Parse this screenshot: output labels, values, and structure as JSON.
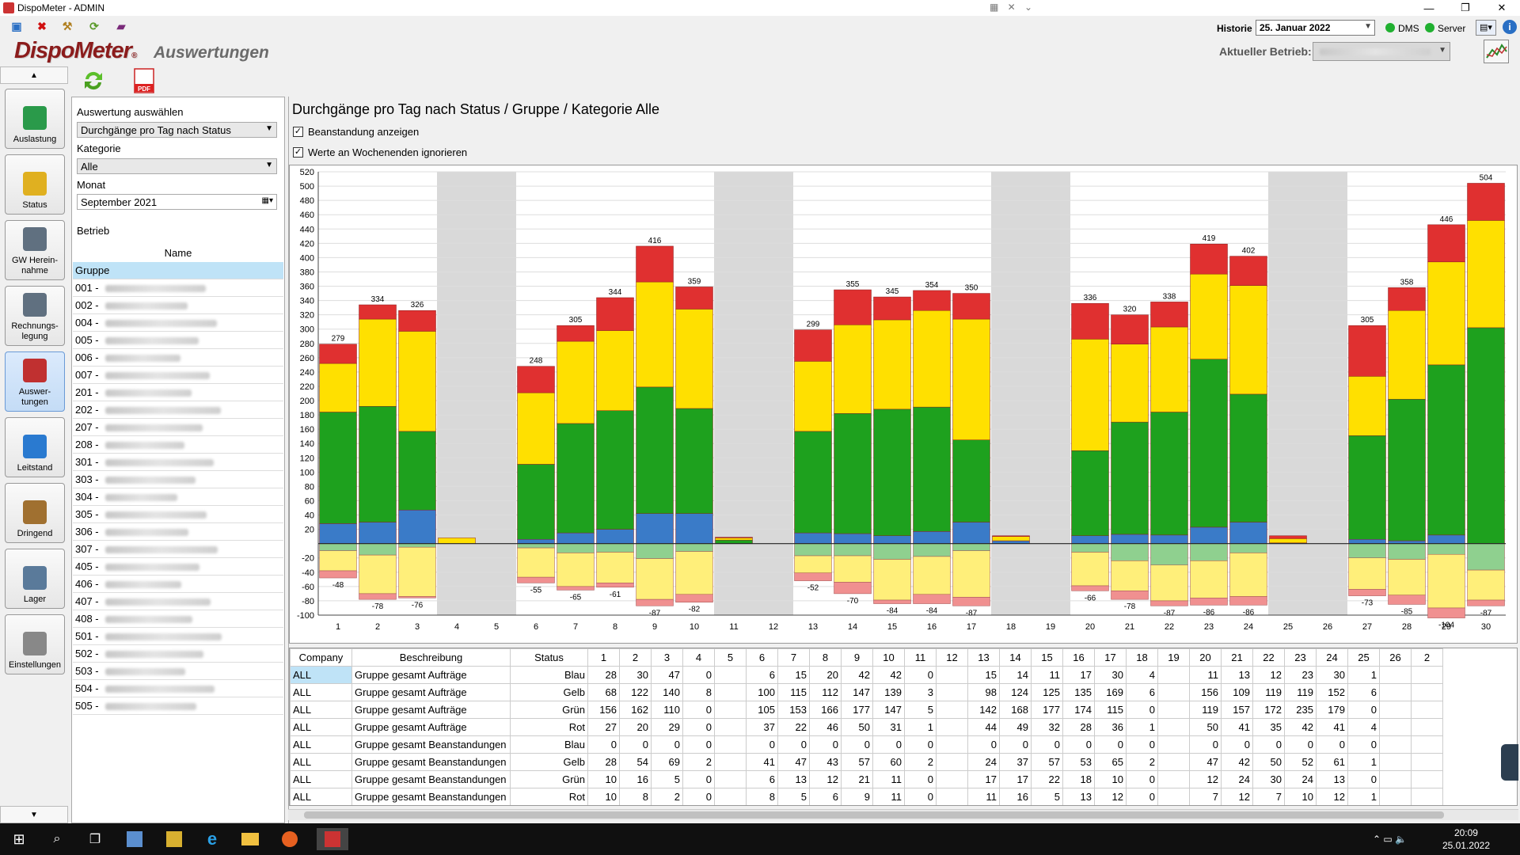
{
  "window": {
    "title": "DispoMeter - ADMIN"
  },
  "header": {
    "historie_label": "Historie",
    "historie_value": "25. Januar 2022",
    "dms_label": "DMS",
    "server_label": "Server",
    "logo": "DispoMeter",
    "subtitle": "Auswertungen",
    "betrieb_label": "Aktueller Betrieb:"
  },
  "nav": [
    {
      "label": "Auslastung",
      "icon": "cubes-icon",
      "active": false
    },
    {
      "label": "Status",
      "icon": "clipboard-icon",
      "active": false
    },
    {
      "label": "GW Herein-\nnahme",
      "icon": "car-icon",
      "active": false
    },
    {
      "label": "Rechnungs-\nlegung",
      "icon": "calculator-icon",
      "active": false
    },
    {
      "label": "Auswer-\ntungen",
      "icon": "chart-icon",
      "active": true
    },
    {
      "label": "Leitstand",
      "icon": "monitor-icon",
      "active": false
    },
    {
      "label": "Dringend",
      "icon": "moneybag-icon",
      "active": false
    },
    {
      "label": "Lager",
      "icon": "basket-icon",
      "active": false
    },
    {
      "label": "Einstellungen",
      "icon": "gear-icon",
      "active": false
    }
  ],
  "left": {
    "auswertung_label": "Auswertung auswählen",
    "auswertung_value": "Durchgänge pro Tag nach Status",
    "kategorie_label": "Kategorie",
    "kategorie_value": "Alle",
    "monat_label": "Monat",
    "monat_value": "September 2021",
    "betrieb_label": "Betrieb",
    "name_header": "Name",
    "rows": [
      "Gruppe",
      "001 -",
      "002 -",
      "004 -",
      "005 -",
      "006 -",
      "007 -",
      "201 -",
      "202 -",
      "207 -",
      "208 -",
      "301 -",
      "303 -",
      "304 -",
      "305 -",
      "306 -",
      "307 -",
      "405 -",
      "406 -",
      "407 -",
      "408 -",
      "501 -",
      "502 -",
      "503 -",
      "504 -",
      "505 -"
    ]
  },
  "main": {
    "title": "Durchgänge pro Tag nach Status / Gruppe / Kategorie Alle",
    "check1": "Beanstandung anzeigen",
    "check2": "Werte an Wochenenden ignorieren"
  },
  "colors": {
    "blau": "#3a7bc8",
    "gelb": "#ffe000",
    "gruen": "#1ea11e",
    "rot": "#e03030",
    "weekend": "#d9d9d9"
  },
  "chart_data": {
    "type": "bar",
    "stacked": true,
    "x": [
      1,
      2,
      3,
      4,
      5,
      6,
      7,
      8,
      9,
      10,
      11,
      12,
      13,
      14,
      15,
      16,
      17,
      18,
      19,
      20,
      21,
      22,
      23,
      24,
      25,
      26,
      27,
      28,
      29,
      30
    ],
    "weekend_days": [
      4,
      5,
      11,
      12,
      18,
      19,
      25,
      26
    ],
    "ylim": [
      -100,
      520
    ],
    "yticks": [
      -100,
      -80,
      -60,
      -40,
      -20,
      20,
      40,
      60,
      80,
      100,
      120,
      140,
      160,
      180,
      200,
      220,
      240,
      260,
      280,
      300,
      320,
      340,
      360,
      380,
      400,
      420,
      440,
      460,
      480,
      500,
      520
    ],
    "series": [
      {
        "name": "Blau",
        "values": [
          28,
          30,
          47,
          0,
          0,
          6,
          15,
          20,
          42,
          42,
          0,
          0,
          15,
          14,
          11,
          17,
          30,
          4,
          0,
          11,
          13,
          12,
          23,
          30,
          1,
          0,
          6,
          4,
          12,
          0
        ]
      },
      {
        "name": "Grün",
        "values": [
          156,
          162,
          110,
          0,
          0,
          105,
          153,
          166,
          177,
          147,
          5,
          0,
          142,
          168,
          177,
          174,
          115,
          0,
          0,
          119,
          157,
          172,
          235,
          179,
          0,
          0,
          145,
          198,
          238,
          302
        ]
      },
      {
        "name": "Gelb",
        "values": [
          68,
          122,
          140,
          8,
          0,
          100,
          115,
          112,
          147,
          139,
          3,
          0,
          98,
          124,
          125,
          135,
          169,
          6,
          0,
          156,
          109,
          119,
          119,
          152,
          6,
          0,
          83,
          124,
          144,
          150
        ]
      },
      {
        "name": "Rot",
        "values": [
          27,
          20,
          29,
          0,
          0,
          37,
          22,
          46,
          50,
          31,
          1,
          0,
          44,
          49,
          32,
          28,
          36,
          1,
          0,
          50,
          41,
          35,
          42,
          41,
          4,
          0,
          71,
          32,
          52,
          52
        ]
      }
    ],
    "totals": [
      279,
      334,
      326,
      null,
      null,
      248,
      305,
      344,
      416,
      359,
      null,
      null,
      299,
      355,
      345,
      354,
      350,
      null,
      null,
      336,
      320,
      338,
      419,
      402,
      null,
      null,
      305,
      358,
      446,
      504
    ],
    "negative_series": [
      {
        "name": "Beanstandungen Blau",
        "values": [
          0,
          0,
          0,
          0,
          0,
          0,
          0,
          0,
          0,
          0,
          0,
          0,
          0,
          0,
          0,
          0,
          0,
          0,
          0,
          0,
          0,
          0,
          0,
          0,
          0,
          0,
          0,
          0,
          0,
          0
        ]
      },
      {
        "name": "Beanstandungen Grün",
        "values": [
          10,
          16,
          5,
          0,
          0,
          6,
          13,
          12,
          21,
          11,
          0,
          0,
          17,
          17,
          22,
          18,
          10,
          0,
          0,
          12,
          24,
          30,
          24,
          13,
          0,
          0,
          20,
          22,
          15,
          37
        ]
      },
      {
        "name": "Beanstandungen Gelb",
        "values": [
          28,
          54,
          69,
          0,
          0,
          41,
          47,
          43,
          57,
          60,
          0,
          0,
          24,
          37,
          57,
          53,
          65,
          0,
          0,
          47,
          42,
          50,
          52,
          61,
          0,
          0,
          44,
          50,
          75,
          42
        ]
      },
      {
        "name": "Beanstandungen Rot",
        "values": [
          10,
          8,
          2,
          0,
          0,
          8,
          5,
          6,
          9,
          11,
          0,
          0,
          11,
          16,
          5,
          13,
          12,
          0,
          0,
          7,
          12,
          7,
          10,
          12,
          0,
          0,
          9,
          13,
          14,
          8
        ]
      }
    ],
    "neg_totals": [
      -48,
      -78,
      -76,
      null,
      null,
      -55,
      -65,
      -61,
      -87,
      -82,
      null,
      null,
      -52,
      -70,
      -84,
      -84,
      -87,
      null,
      null,
      -66,
      -78,
      -87,
      -86,
      -86,
      null,
      null,
      -73,
      -85,
      -104,
      -87
    ]
  },
  "table": {
    "headers": [
      "Company",
      "Beschreibung",
      "Status",
      "1",
      "2",
      "3",
      "4",
      "5",
      "6",
      "7",
      "8",
      "9",
      "10",
      "11",
      "12",
      "13",
      "14",
      "15",
      "16",
      "17",
      "18",
      "19",
      "20",
      "21",
      "22",
      "23",
      "24",
      "25",
      "26",
      "2"
    ],
    "rows": [
      [
        "ALL",
        "Gruppe gesamt Aufträge",
        "Blau",
        "28",
        "30",
        "47",
        "0",
        "",
        "6",
        "15",
        "20",
        "42",
        "42",
        "0",
        "",
        "15",
        "14",
        "11",
        "17",
        "30",
        "4",
        "",
        "11",
        "13",
        "12",
        "23",
        "30",
        "1",
        "",
        ""
      ],
      [
        "ALL",
        "Gruppe gesamt Aufträge",
        "Gelb",
        "68",
        "122",
        "140",
        "8",
        "",
        "100",
        "115",
        "112",
        "147",
        "139",
        "3",
        "",
        "98",
        "124",
        "125",
        "135",
        "169",
        "6",
        "",
        "156",
        "109",
        "119",
        "119",
        "152",
        "6",
        "",
        ""
      ],
      [
        "ALL",
        "Gruppe gesamt Aufträge",
        "Grün",
        "156",
        "162",
        "110",
        "0",
        "",
        "105",
        "153",
        "166",
        "177",
        "147",
        "5",
        "",
        "142",
        "168",
        "177",
        "174",
        "115",
        "0",
        "",
        "119",
        "157",
        "172",
        "235",
        "179",
        "0",
        "",
        ""
      ],
      [
        "ALL",
        "Gruppe gesamt Aufträge",
        "Rot",
        "27",
        "20",
        "29",
        "0",
        "",
        "37",
        "22",
        "46",
        "50",
        "31",
        "1",
        "",
        "44",
        "49",
        "32",
        "28",
        "36",
        "1",
        "",
        "50",
        "41",
        "35",
        "42",
        "41",
        "4",
        "",
        ""
      ],
      [
        "ALL",
        "Gruppe gesamt Beanstandungen",
        "Blau",
        "0",
        "0",
        "0",
        "0",
        "",
        "0",
        "0",
        "0",
        "0",
        "0",
        "0",
        "",
        "0",
        "0",
        "0",
        "0",
        "0",
        "0",
        "",
        "0",
        "0",
        "0",
        "0",
        "0",
        "0",
        "",
        ""
      ],
      [
        "ALL",
        "Gruppe gesamt Beanstandungen",
        "Gelb",
        "28",
        "54",
        "69",
        "2",
        "",
        "41",
        "47",
        "43",
        "57",
        "60",
        "2",
        "",
        "24",
        "37",
        "57",
        "53",
        "65",
        "2",
        "",
        "47",
        "42",
        "50",
        "52",
        "61",
        "1",
        "",
        ""
      ],
      [
        "ALL",
        "Gruppe gesamt Beanstandungen",
        "Grün",
        "10",
        "16",
        "5",
        "0",
        "",
        "6",
        "13",
        "12",
        "21",
        "11",
        "0",
        "",
        "17",
        "17",
        "22",
        "18",
        "10",
        "0",
        "",
        "12",
        "24",
        "30",
        "24",
        "13",
        "0",
        "",
        ""
      ],
      [
        "ALL",
        "Gruppe gesamt Beanstandungen",
        "Rot",
        "10",
        "8",
        "2",
        "0",
        "",
        "8",
        "5",
        "6",
        "9",
        "11",
        "0",
        "",
        "11",
        "16",
        "5",
        "13",
        "12",
        "0",
        "",
        "7",
        "12",
        "7",
        "10",
        "12",
        "1",
        "",
        ""
      ]
    ]
  },
  "taskbar": {
    "time": "20:09",
    "date": "25.01.2022"
  }
}
